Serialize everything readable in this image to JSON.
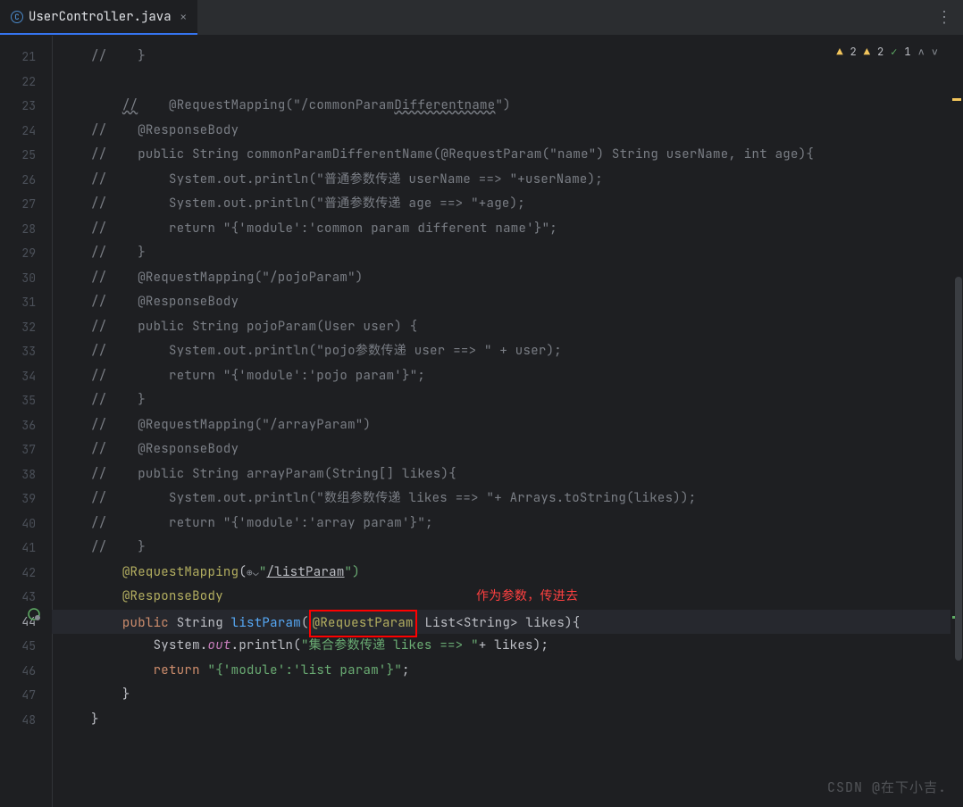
{
  "tab": {
    "filename": "UserController.java",
    "icon_letter": "C"
  },
  "inspection": {
    "warn1": "2",
    "warn2": "2",
    "check": "1"
  },
  "gutter": {
    "start": 21,
    "end": 48
  },
  "code": {
    "l21": {
      "cm": "//",
      "txt": "    }"
    },
    "l23": {
      "cm": "//",
      "ann": "@RequestMapping(\"/commonParam",
      "diff": "Differentname",
      "end": "\")"
    },
    "l24": {
      "cm": "//",
      "txt": "    @ResponseBody"
    },
    "l25": {
      "cm": "//",
      "txt": "    public String commonParamDifferentName(@RequestParam(\"name\") String userName, int age){"
    },
    "l26": {
      "cm": "//",
      "txt": "        System.out.println(\"普通参数传递 userName ==> \"+userName);"
    },
    "l27": {
      "cm": "//",
      "txt": "        System.out.println(\"普通参数传递 age ==> \"+age);"
    },
    "l28": {
      "cm": "//",
      "txt": "        return \"{'module':'common param different name'}\";"
    },
    "l29": {
      "cm": "//",
      "txt": "    }"
    },
    "l30": {
      "cm": "//",
      "txt": "    @RequestMapping(\"/pojoParam\")"
    },
    "l31": {
      "cm": "//",
      "txt": "    @ResponseBody"
    },
    "l32": {
      "cm": "//",
      "txt": "    public String pojoParam(User user) {"
    },
    "l33": {
      "cm": "//",
      "txt": "        System.out.println(\"pojo参数传递 user ==> \" + user);"
    },
    "l34": {
      "cm": "//",
      "txt": "        return \"{'module':'pojo param'}\";"
    },
    "l35": {
      "cm": "//",
      "txt": "    }"
    },
    "l36": {
      "cm": "//",
      "txt": "    @RequestMapping(\"/arrayParam\")"
    },
    "l37": {
      "cm": "//",
      "txt": "    @ResponseBody"
    },
    "l38": {
      "cm": "//",
      "txt": "    public String arrayParam(String[] likes){"
    },
    "l39": {
      "cm": "//",
      "txt": "        System.out.println(\"数组参数传递 likes ==> \"+ Arrays.toString(likes));"
    },
    "l40": {
      "cm": "//",
      "txt": "        return \"{'module':'array param'}\";"
    },
    "l41": {
      "cm": "//",
      "txt": "    }"
    },
    "l42": {
      "ann": "@RequestMapping",
      "paren": "(",
      "url": "/listParam",
      "strend": "\")"
    },
    "l43": {
      "ann": "@ResponseBody"
    },
    "l44": {
      "kw1": "public",
      "kw2": "String",
      "method": "listParam",
      "paren": "(",
      "boxed": "@RequestParam",
      "rest": " List<String> likes){"
    },
    "l45": {
      "sys": "System.",
      "out": "out",
      "println": ".println(",
      "str": "\"集合参数传递 likes ==> \"",
      "rest": "+ likes);"
    },
    "l46": {
      "kw": "return",
      "str": "\"{'module':'list param'}\"",
      "semi": ";"
    },
    "l47": {
      "brace": "}"
    },
    "l48": {
      "brace": "}"
    }
  },
  "annotation_text": "作为参数，传进去",
  "watermark": "CSDN @在下小吉."
}
